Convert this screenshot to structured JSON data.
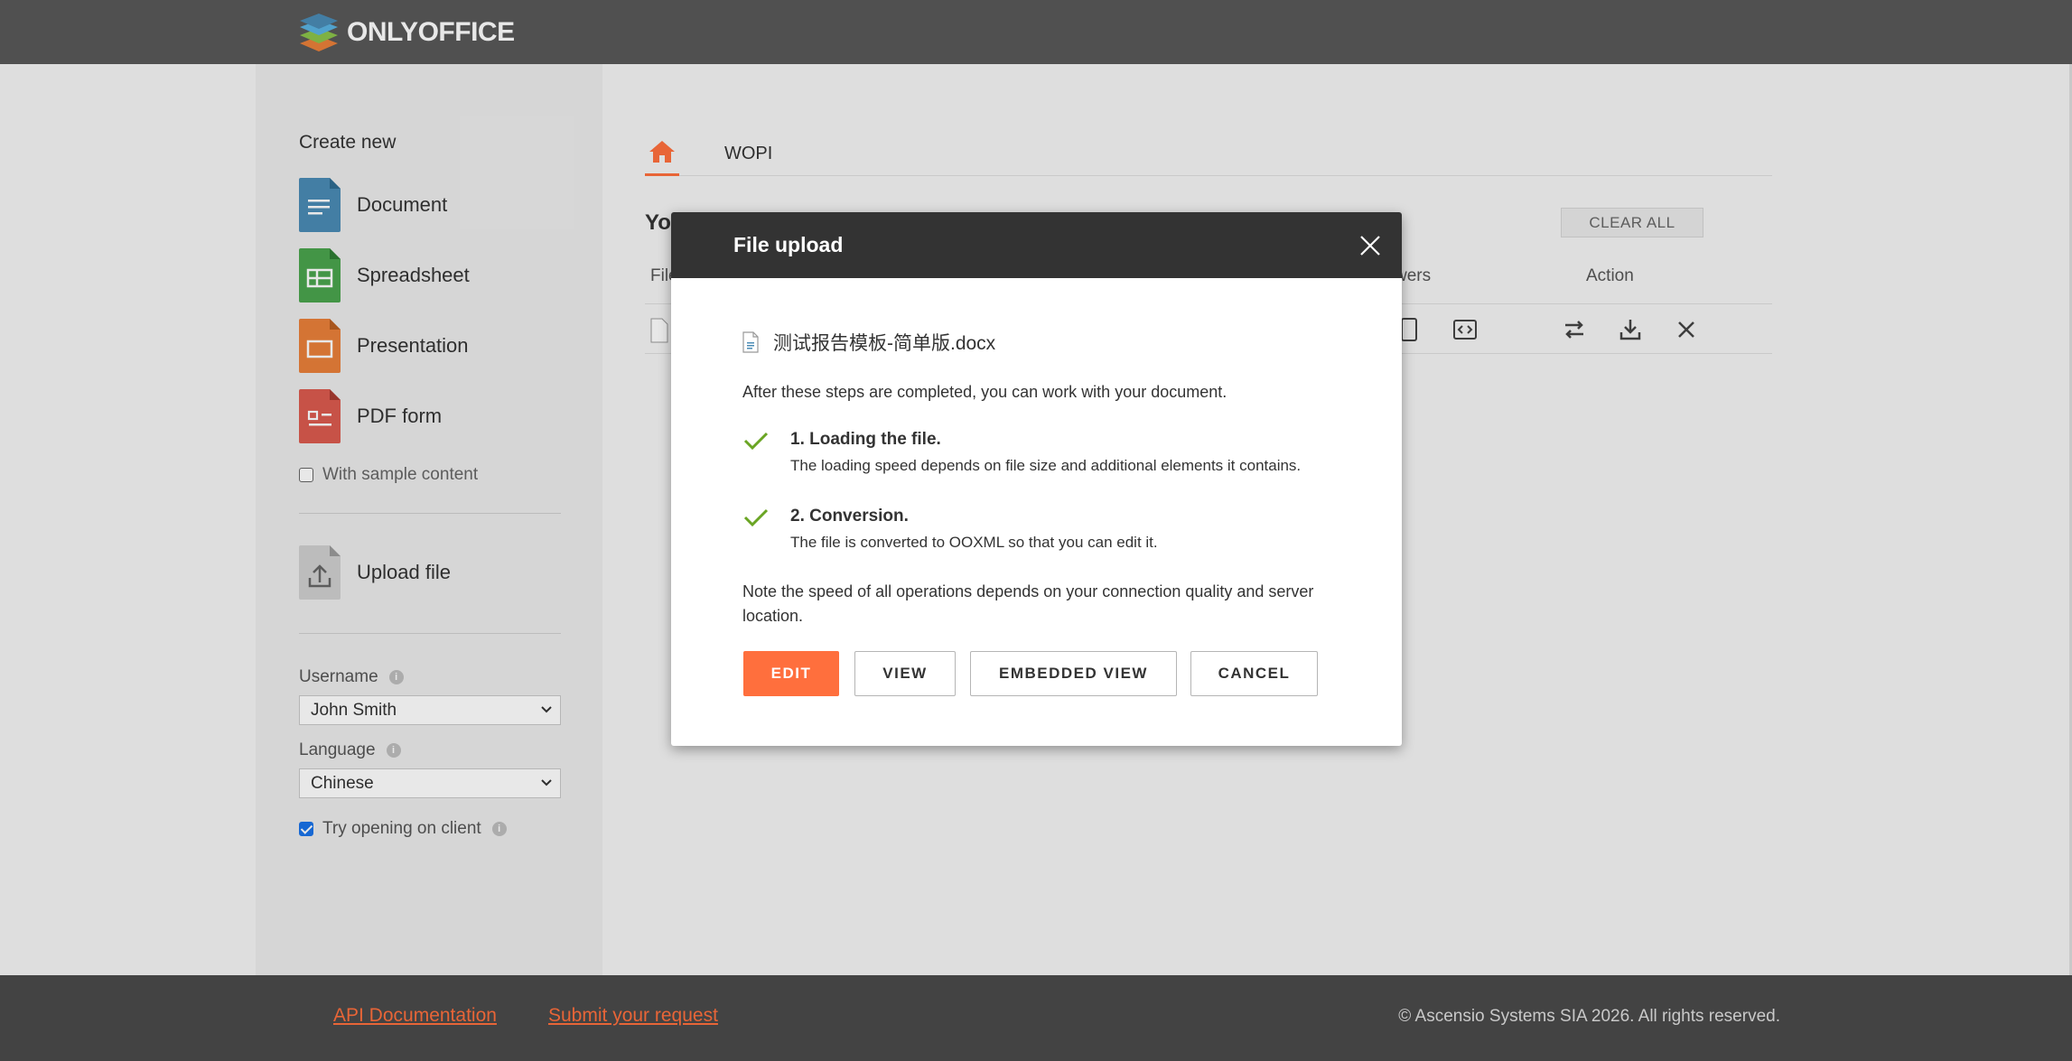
{
  "header": {
    "logo_text": "ONLYOFFICE"
  },
  "sidebar": {
    "create_title": "Create new",
    "create_items": [
      {
        "label": "Document",
        "color": "#4a8bb5"
      },
      {
        "label": "Spreadsheet",
        "color": "#4aa44e"
      },
      {
        "label": "Presentation",
        "color": "#e9803a"
      },
      {
        "label": "PDF form",
        "color": "#db5b4f"
      }
    ],
    "sample_content_label": "With sample content",
    "upload_label": "Upload file",
    "username_label": "Username",
    "username_value": "John Smith",
    "language_label": "Language",
    "language_value": "Chinese",
    "try_client_label": "Try opening on client"
  },
  "content": {
    "tabs": {
      "wopi": "WOPI"
    },
    "your_files_partial": "Yo",
    "clear_all": "CLEAR ALL",
    "col_file_partial": "File",
    "col_viewers_partial": "wers",
    "col_action": "Action"
  },
  "footer": {
    "api_docs": "API Documentation",
    "submit_request": "Submit your request",
    "copyright": "© Ascensio Systems SIA 2026. All rights reserved."
  },
  "modal": {
    "title": "File upload",
    "file_name": "测试报告模板-简单版.docx",
    "intro": "After these steps are completed, you can work with your document.",
    "steps": [
      {
        "title": "1. Loading the file.",
        "desc": "The loading speed depends on file size and additional elements it contains."
      },
      {
        "title": "2. Conversion.",
        "desc": "The file is converted to OOXML so that you can edit it."
      }
    ],
    "note": "Note the speed of all operations depends on your connection quality and server location.",
    "buttons": {
      "edit": "EDIT",
      "view": "VIEW",
      "embedded_view": "EMBEDDED VIEW",
      "cancel": "CANCEL"
    }
  },
  "colors": {
    "accent": "#ff6f3d",
    "header": "#585858",
    "modal_header": "#333333",
    "check": "#6aa524"
  }
}
